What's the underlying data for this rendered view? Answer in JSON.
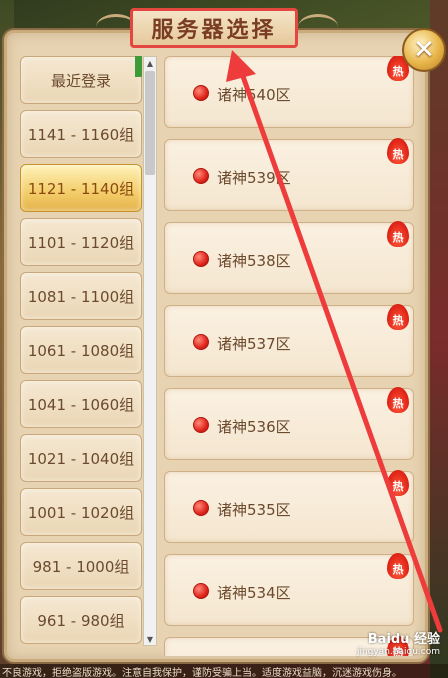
{
  "dialog": {
    "title": "服务器选择",
    "close_icon": "✕"
  },
  "group_list": {
    "items": [
      {
        "label": "最近登录",
        "selected": false,
        "flag": true
      },
      {
        "label": "1141 - 1160组",
        "selected": false
      },
      {
        "label": "1121 - 1140组",
        "selected": true
      },
      {
        "label": "1101 - 1120组",
        "selected": false
      },
      {
        "label": "1081 - 1100组",
        "selected": false
      },
      {
        "label": "1061 - 1080组",
        "selected": false
      },
      {
        "label": "1041 - 1060组",
        "selected": false
      },
      {
        "label": "1021 - 1040组",
        "selected": false
      },
      {
        "label": "1001 - 1020组",
        "selected": false
      },
      {
        "label": "981 - 1000组",
        "selected": false
      },
      {
        "label": "961 - 980组",
        "selected": false
      }
    ]
  },
  "scrollbar": {
    "up_glyph": "▲",
    "down_glyph": "▼"
  },
  "server_list": {
    "hot_label": "热",
    "items": [
      {
        "name": "诸神540区",
        "status_color": "#e0251c"
      },
      {
        "name": "诸神539区",
        "status_color": "#e0251c"
      },
      {
        "name": "诸神538区",
        "status_color": "#e0251c"
      },
      {
        "name": "诸神537区",
        "status_color": "#e0251c"
      },
      {
        "name": "诸神536区",
        "status_color": "#e0251c"
      },
      {
        "name": "诸神535区",
        "status_color": "#e0251c"
      },
      {
        "name": "诸神534区",
        "status_color": "#e0251c"
      },
      {
        "name": "",
        "status_color": "#e0251c"
      }
    ]
  },
  "annotation": {
    "color": "#ee3b3b"
  },
  "footer": {
    "text": "不良游戏，拒绝盗版游戏。注意自我保护，谨防受骗上当。适度游戏益脑，沉迷游戏伤身。"
  },
  "watermark": {
    "main": "Baidu 经验",
    "url": "jingyan.baidu.com"
  }
}
